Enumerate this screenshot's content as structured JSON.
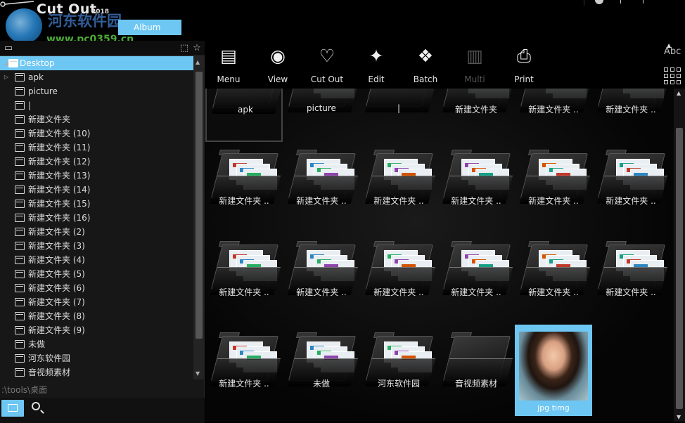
{
  "app": {
    "title": "Cut Out",
    "title_year": "2018",
    "album_tab": "Album",
    "watermark_site": "河东软件园",
    "watermark_url": "www.pc0359.cn"
  },
  "toolbar": {
    "buttons": [
      {
        "label": "Menu",
        "icon": "menu-doc-icon",
        "enabled": true
      },
      {
        "label": "View",
        "icon": "eye-icon",
        "enabled": true
      },
      {
        "label": "Cut Out",
        "icon": "heart-scissor-icon",
        "enabled": true
      },
      {
        "label": "Edit",
        "icon": "magic-wand-icon",
        "enabled": true
      },
      {
        "label": "Batch",
        "icon": "stack-icon",
        "enabled": true
      },
      {
        "label": "Multi",
        "icon": "multi-pages-icon",
        "enabled": false
      },
      {
        "label": "Print",
        "icon": "printer-icon",
        "enabled": true
      }
    ],
    "sort_label": "Abc"
  },
  "tree": {
    "root": "Desktop",
    "items": [
      {
        "label": "apk",
        "expandable": true
      },
      {
        "label": "picture",
        "expandable": false
      },
      {
        "label": "|",
        "expandable": false
      },
      {
        "label": "新建文件夹",
        "expandable": false
      },
      {
        "label": "新建文件夹 (10)",
        "expandable": false
      },
      {
        "label": "新建文件夹 (11)",
        "expandable": false
      },
      {
        "label": "新建文件夹 (12)",
        "expandable": false
      },
      {
        "label": "新建文件夹 (13)",
        "expandable": false
      },
      {
        "label": "新建文件夹 (14)",
        "expandable": false
      },
      {
        "label": "新建文件夹 (15)",
        "expandable": false
      },
      {
        "label": "新建文件夹 (16)",
        "expandable": false
      },
      {
        "label": "新建文件夹 (2)",
        "expandable": false
      },
      {
        "label": "新建文件夹 (3)",
        "expandable": false
      },
      {
        "label": "新建文件夹 (4)",
        "expandable": false
      },
      {
        "label": "新建文件夹 (5)",
        "expandable": false
      },
      {
        "label": "新建文件夹 (6)",
        "expandable": false
      },
      {
        "label": "新建文件夹 (7)",
        "expandable": false
      },
      {
        "label": "新建文件夹 (8)",
        "expandable": false
      },
      {
        "label": "新建文件夹 (9)",
        "expandable": false
      },
      {
        "label": "未做",
        "expandable": false
      },
      {
        "label": "河东软件园",
        "expandable": false
      },
      {
        "label": "音视频素材",
        "expandable": false
      }
    ],
    "path": ":\\tools\\桌面"
  },
  "thumbnails": [
    {
      "caption": "apk",
      "type": "folder-empty"
    },
    {
      "caption": "picture",
      "type": "folder"
    },
    {
      "caption": "|",
      "type": "folder-empty"
    },
    {
      "caption": "新建文件夹",
      "type": "folder"
    },
    {
      "caption": "新建文件夹 ..",
      "type": "folder"
    },
    {
      "caption": "新建文件夹 ..",
      "type": "folder"
    },
    {
      "caption": "新建文件夹 ..",
      "type": "folder"
    },
    {
      "caption": "新建文件夹 ..",
      "type": "folder"
    },
    {
      "caption": "新建文件夹 ..",
      "type": "folder"
    },
    {
      "caption": "新建文件夹 ..",
      "type": "folder"
    },
    {
      "caption": "新建文件夹 ..",
      "type": "folder"
    },
    {
      "caption": "新建文件夹 ..",
      "type": "folder"
    },
    {
      "caption": "新建文件夹 ..",
      "type": "folder"
    },
    {
      "caption": "新建文件夹 ..",
      "type": "folder"
    },
    {
      "caption": "新建文件夹 ..",
      "type": "folder"
    },
    {
      "caption": "新建文件夹 ..",
      "type": "folder"
    },
    {
      "caption": "新建文件夹 ..",
      "type": "folder"
    },
    {
      "caption": "新建文件夹 ..",
      "type": "folder"
    },
    {
      "caption": "新建文件夹 ..",
      "type": "folder"
    },
    {
      "caption": "未做",
      "type": "folder"
    },
    {
      "caption": "河东软件园",
      "type": "folder"
    },
    {
      "caption": "音视频素材",
      "type": "folder-empty"
    },
    {
      "caption": "jpg timg",
      "type": "photo"
    }
  ],
  "colors": {
    "accent": "#6ec7f2",
    "background": "#000000",
    "panel": "#171717"
  }
}
